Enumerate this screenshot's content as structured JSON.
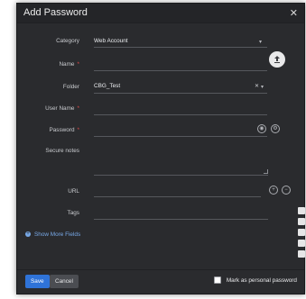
{
  "dialog": {
    "title": "Add Password",
    "close_glyph": "✕"
  },
  "form": {
    "category": {
      "label": "Category",
      "value": "Web Account"
    },
    "name": {
      "label": "Name",
      "required_mark": "*"
    },
    "folder": {
      "label": "Folder",
      "value": "CBG_Test"
    },
    "username": {
      "label": "User Name",
      "required_mark": "*"
    },
    "password": {
      "label": "Password",
      "required_mark": "*"
    },
    "notes": {
      "label": "Secure notes"
    },
    "url": {
      "label": "URL"
    },
    "tags": {
      "label": "Tags"
    },
    "show_more": "Show More Fields"
  },
  "footer": {
    "save_label": "Save",
    "cancel_label": "Cancel",
    "personal_label": "Mark as personal password"
  },
  "icons": {
    "upload": "upload-icon",
    "eye": "eye-icon",
    "generator": "password-generator-icon",
    "add": "add-circle-icon",
    "remove": "remove-circle-icon"
  },
  "colors": {
    "background": "#2a2b2e",
    "accent": "#2f73d8",
    "link": "#78a9e8",
    "required": "#e04848"
  }
}
